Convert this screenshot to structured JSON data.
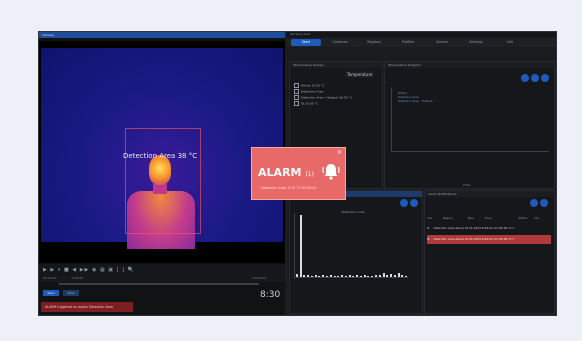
{
  "left_pane": {
    "title": "Camera",
    "detection_label": "Detection Area  38 °C",
    "controls_icons": "▶ ▶ ⏸ ■ ◀ ▶▶ ◉ ▦ ▣ [ ] 🔍",
    "time_start": "00:00:00",
    "time_mid": "0:00:00",
    "time_end": "0:00:00.0",
    "clock": "8:30",
    "btn_a": "Start",
    "btn_b": "Stop",
    "alarm_message": "ALARM triggered on region Detection Area"
  },
  "right_pane": {
    "window_title": "Working Area",
    "tabs": [
      {
        "label": "Start",
        "active": true
      },
      {
        "label": "Cameras",
        "active": false
      },
      {
        "label": "Regions",
        "active": false
      },
      {
        "label": "Profiles",
        "active": false
      },
      {
        "label": "Alarms",
        "active": false
      },
      {
        "label": "Settings",
        "active": false
      },
      {
        "label": "Info",
        "active": false
      }
    ],
    "temp_display": {
      "header": "Temperature Display",
      "dropdown": "Temperature",
      "items": [
        {
          "label": "Whole",
          "value": "32.00 °C"
        },
        {
          "label": "Detection Area",
          "value": ""
        },
        {
          "label": "Detection Area - Hotspot",
          "value": "38.00 °C"
        },
        {
          "label": "ID",
          "value": "29.00 °C"
        }
      ]
    },
    "temp_diagram": {
      "header": "Temperature Diagram",
      "series": [
        "Whole",
        "Detection Area",
        "Detection Area - Hotspot"
      ],
      "x_label": "Time"
    },
    "histogram": {
      "header": "Histogram",
      "title": "Detection Area"
    },
    "alarm_notifications": {
      "header": "Alarm Notifications",
      "columns": [
        "Ack",
        "Region",
        "Type",
        "Time",
        "Status",
        "Val"
      ],
      "rows": [
        {
          "text": "Detection Area  above   01.01.2023 8:28:21   Ack 80.00   37.7",
          "alert": false
        },
        {
          "text": "Detection Area  above   01.01.2023 8:29:52   Ack 80.00   37.7",
          "alert": true
        }
      ]
    }
  },
  "alarm_popup": {
    "title": "ALARM",
    "count": "(1)",
    "close": "×",
    "subtitle": "Detection Area    37.8 °C    00:00:20"
  },
  "chart_data": {
    "type": "bar",
    "title": "Detection Area",
    "categories": [
      "1",
      "2",
      "3",
      "4",
      "5",
      "6",
      "7",
      "8",
      "9",
      "10",
      "11",
      "12",
      "13",
      "14",
      "15",
      "16",
      "17",
      "18",
      "19",
      "20",
      "21",
      "22",
      "23",
      "24",
      "25",
      "26",
      "27",
      "28",
      "29",
      "30"
    ],
    "values": [
      5,
      100,
      4,
      4,
      2,
      3,
      2,
      4,
      2,
      3,
      2,
      2,
      3,
      2,
      3,
      2,
      3,
      2,
      4,
      2,
      2,
      4,
      3,
      6,
      4,
      5,
      3,
      6,
      4,
      2
    ],
    "ylim": [
      0,
      100
    ]
  }
}
